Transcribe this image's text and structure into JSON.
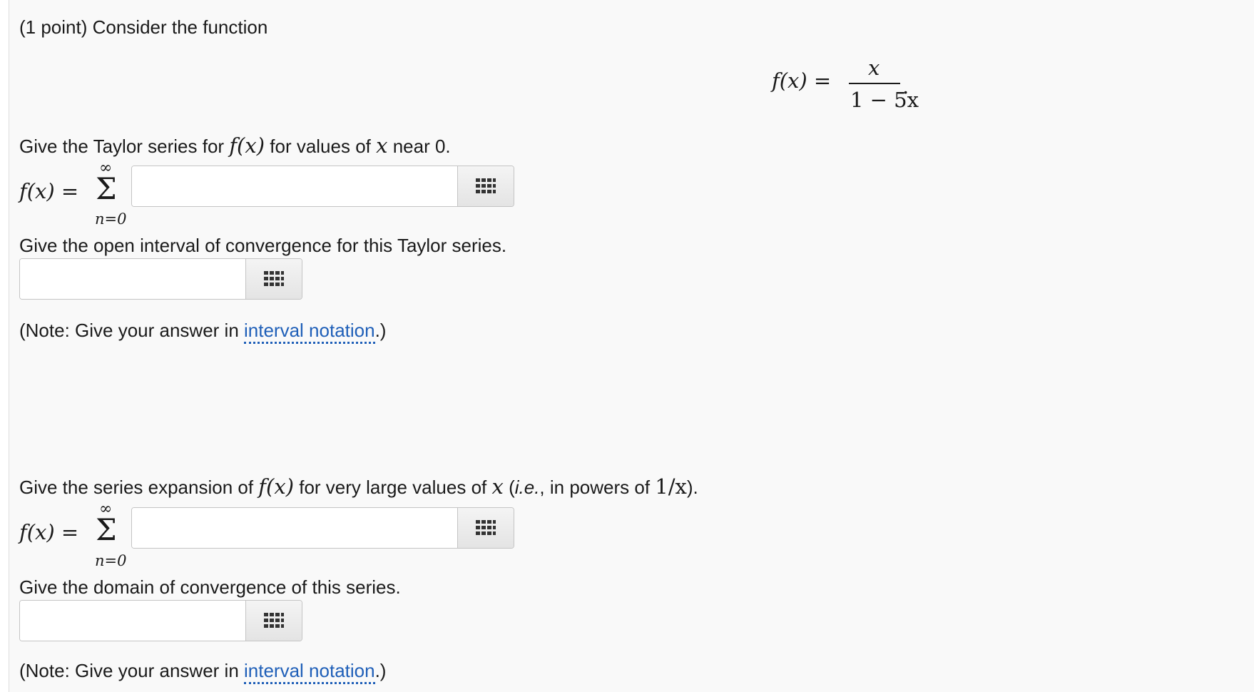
{
  "problem": {
    "intro": "(1 point) Consider the function",
    "function_lhs": "f(x) =",
    "function_numerator": "x",
    "function_denominator": "1 − 5x",
    "function_period": "."
  },
  "part1": {
    "prompt_pre": "Give the Taylor series for ",
    "prompt_fx": "f(x)",
    "prompt_mid": " for values of ",
    "prompt_x": "x",
    "prompt_post": " near 0.",
    "sum_lhs": "f(x) =",
    "sum_upper": "∞",
    "sum_symbol": "Σ",
    "sum_lower": "n=0",
    "answer_value": ""
  },
  "part2": {
    "prompt": "Give the open interval of convergence for this Taylor series.",
    "answer_value": "",
    "note_pre": "(Note: Give your answer in ",
    "note_link": "interval notation",
    "note_post": ".)"
  },
  "part3": {
    "prompt_pre": "Give the series expansion of ",
    "prompt_fx": "f(x)",
    "prompt_mid": " for very large values of ",
    "prompt_x": "x",
    "prompt_paren_open": " (",
    "prompt_ie": "i.e.",
    "prompt_after_ie": ", in powers of ",
    "prompt_power": "1/x",
    "prompt_post": ").",
    "sum_lhs": "f(x) =",
    "sum_upper": "∞",
    "sum_symbol": "Σ",
    "sum_lower": "n=0",
    "answer_value": ""
  },
  "part4": {
    "prompt": "Give the domain of convergence of this series.",
    "answer_value": "",
    "note_pre": "(Note: Give your answer in ",
    "note_link": "interval notation",
    "note_post": ".)"
  },
  "icons": {
    "equation_editor": "grid-icon"
  },
  "colors": {
    "link": "#1f5fb8",
    "panel_bg": "#f9f9f9"
  }
}
